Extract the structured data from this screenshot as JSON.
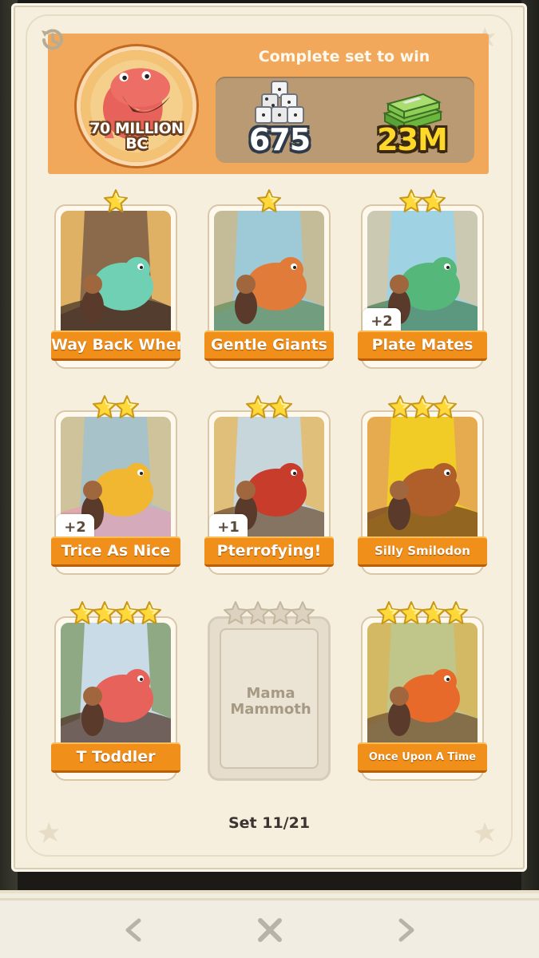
{
  "header": {
    "album_title": "70 MILLION BC",
    "complete_text": "Complete set to win",
    "reward_dice": "675",
    "reward_cash": "23M",
    "icons": [
      "history-icon",
      "dinosaur-badge-icon",
      "dice-icon",
      "cash-stack-icon"
    ]
  },
  "cards": [
    {
      "name": "Way Back When",
      "stars": 1,
      "extra": ""
    },
    {
      "name": "Gentle Giants",
      "stars": 1,
      "extra": ""
    },
    {
      "name": "Plate Mates",
      "stars": 2,
      "extra": "+2"
    },
    {
      "name": "Trice As Nice",
      "stars": 2,
      "extra": "+2"
    },
    {
      "name": "Pterrofying!",
      "stars": 2,
      "extra": "+1"
    },
    {
      "name": "Silly Smilodon",
      "stars": 3,
      "extra": ""
    },
    {
      "name": "T Toddler",
      "stars": 4,
      "extra": ""
    },
    {
      "name": "Mama Mammoth",
      "stars": 4,
      "extra": "",
      "locked": true
    },
    {
      "name": "Once Upon A Time",
      "stars": 4,
      "extra": ""
    }
  ],
  "footer": {
    "set_counter": "Set 11/21"
  },
  "nav": {
    "prev_icon": "chevron-left-icon",
    "close_icon": "close-icon",
    "next_icon": "chevron-right-icon"
  },
  "colors": {
    "header_orange": "#f2a85a",
    "label_orange": "#f08f1a",
    "star_gold": "#ffd83a",
    "panel_bg": "#f6efde"
  }
}
